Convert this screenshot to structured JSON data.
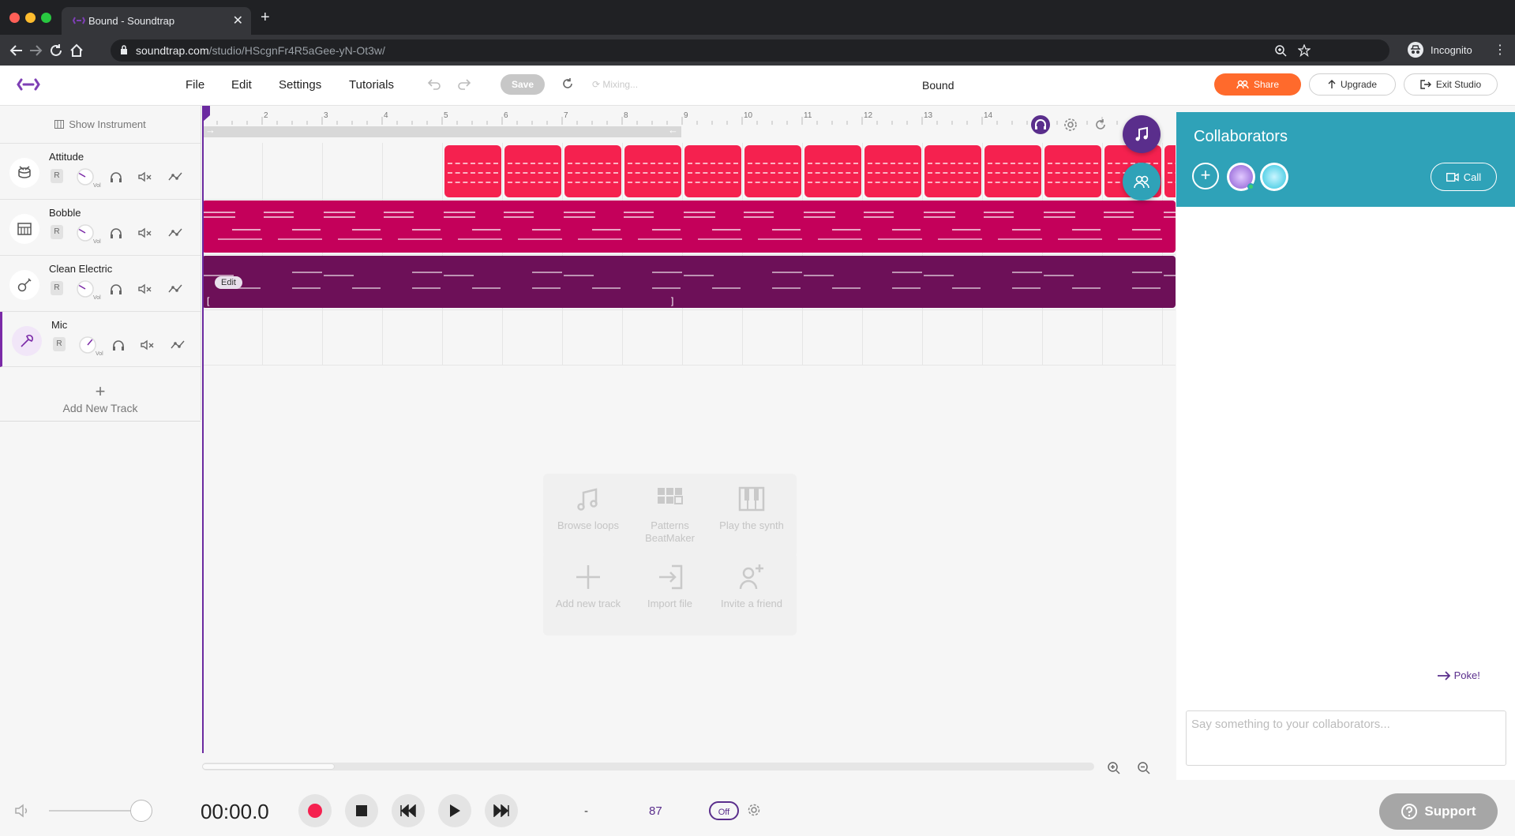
{
  "browser": {
    "tab_title": "Bound - Soundtrap",
    "url_host": "soundtrap.com",
    "url_path": "/studio/HScgnFr4R5aGee-yN-Ot3w/",
    "profile_label": "Incognito"
  },
  "header": {
    "menus": [
      "File",
      "Edit",
      "Settings",
      "Tutorials"
    ],
    "save_label": "Save",
    "mixing_label": "Mixing...",
    "project_title": "Bound",
    "share_label": "Share",
    "upgrade_label": "Upgrade",
    "exit_label": "Exit Studio"
  },
  "tracks": {
    "show_instrument": "Show Instrument",
    "items": [
      {
        "name": "Attitude",
        "icon": "drums-icon",
        "color": "#f5214f"
      },
      {
        "name": "Bobble",
        "icon": "keyboard-icon",
        "color": "#c4005a"
      },
      {
        "name": "Clean Electric",
        "icon": "guitar-icon",
        "color": "#6d1058"
      },
      {
        "name": "Mic",
        "icon": "mic-icon",
        "color": "#7b2aa7"
      }
    ],
    "rec_label": "R",
    "vol_label": "Vol",
    "add_track": "Add New Track"
  },
  "ruler": {
    "bars": [
      "2",
      "3",
      "4",
      "5",
      "6",
      "7",
      "8",
      "9",
      "10",
      "11",
      "12",
      "13",
      "14"
    ]
  },
  "region_edit_label": "Edit",
  "empty_state": {
    "tiles": [
      {
        "label": "Browse loops",
        "icon": "music-note-icon"
      },
      {
        "label": "Patterns BeatMaker",
        "icon": "grid-icon"
      },
      {
        "label": "Play the synth",
        "icon": "piano-icon"
      },
      {
        "label": "Add new track",
        "icon": "plus-icon"
      },
      {
        "label": "Import file",
        "icon": "import-icon"
      },
      {
        "label": "Invite a friend",
        "icon": "invite-icon"
      }
    ]
  },
  "collaborators": {
    "title": "Collaborators",
    "call_label": "Call",
    "poke_label": "Poke!",
    "chat_placeholder": "Say something to your collaborators..."
  },
  "transport": {
    "time": "00:00.0",
    "key": "-",
    "tempo": "87",
    "metronome": "Off",
    "volume_level": 0.9
  },
  "support_label": "Support",
  "colors": {
    "accent": "#5a2e8c",
    "share": "#ff6a2c",
    "collab_header": "#2fa2b8",
    "record": "#f5214f"
  }
}
